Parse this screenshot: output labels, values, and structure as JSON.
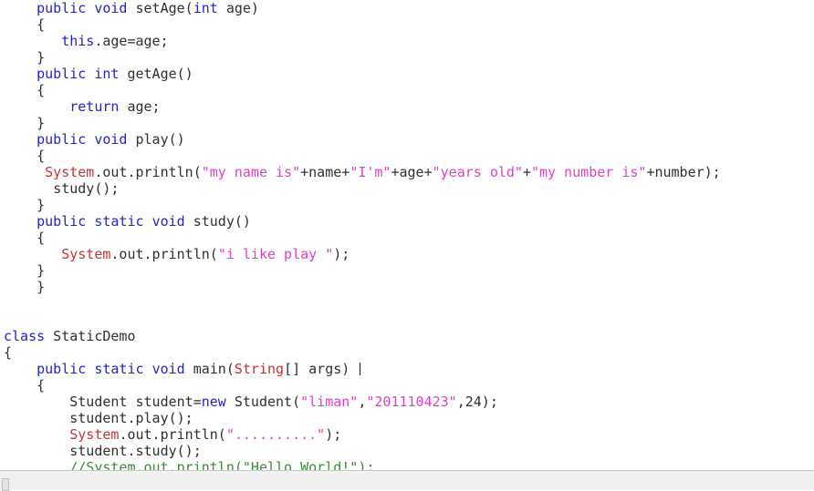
{
  "editor": {
    "language": "java",
    "background_color": "#ffffff",
    "font_size_px": 15,
    "line_height_px": 18,
    "colors": {
      "keyword": "#2424c8",
      "class_name": "#c83232",
      "string": "#e040c8",
      "comment": "#3c8c3c",
      "plain": "#303030"
    },
    "caret_after_line_index": 20,
    "lines": [
      {
        "indent": "    ",
        "tokens": [
          {
            "t": "public",
            "k": "kw"
          },
          {
            "t": " ",
            "k": "plain"
          },
          {
            "t": "void",
            "k": "kw"
          },
          {
            "t": " setAge(",
            "k": "plain"
          },
          {
            "t": "int",
            "k": "kw"
          },
          {
            "t": " age)",
            "k": "plain"
          }
        ]
      },
      {
        "indent": "    ",
        "tokens": [
          {
            "t": "{",
            "k": "plain"
          }
        ]
      },
      {
        "indent": "       ",
        "tokens": [
          {
            "t": "this",
            "k": "kw"
          },
          {
            "t": ".age=age;",
            "k": "plain"
          }
        ]
      },
      {
        "indent": "    ",
        "tokens": [
          {
            "t": "}",
            "k": "plain"
          }
        ]
      },
      {
        "indent": "    ",
        "tokens": [
          {
            "t": "public",
            "k": "kw"
          },
          {
            "t": " ",
            "k": "plain"
          },
          {
            "t": "int",
            "k": "kw"
          },
          {
            "t": " getAge()",
            "k": "plain"
          }
        ]
      },
      {
        "indent": "    ",
        "tokens": [
          {
            "t": "{",
            "k": "plain"
          }
        ]
      },
      {
        "indent": "        ",
        "tokens": [
          {
            "t": "return",
            "k": "kw"
          },
          {
            "t": " age;",
            "k": "plain"
          }
        ]
      },
      {
        "indent": "    ",
        "tokens": [
          {
            "t": "}",
            "k": "plain"
          }
        ]
      },
      {
        "indent": "    ",
        "tokens": [
          {
            "t": "public",
            "k": "kw"
          },
          {
            "t": " ",
            "k": "plain"
          },
          {
            "t": "void",
            "k": "kw"
          },
          {
            "t": " play()",
            "k": "plain"
          }
        ]
      },
      {
        "indent": "    ",
        "tokens": [
          {
            "t": "{",
            "k": "plain"
          }
        ]
      },
      {
        "indent": "     ",
        "tokens": [
          {
            "t": "System",
            "k": "cls"
          },
          {
            "t": ".out.println(",
            "k": "plain"
          },
          {
            "t": "\"my name is\"",
            "k": "str"
          },
          {
            "t": "+name+",
            "k": "plain"
          },
          {
            "t": "\"I'm\"",
            "k": "str"
          },
          {
            "t": "+age+",
            "k": "plain"
          },
          {
            "t": "\"years old\"",
            "k": "str"
          },
          {
            "t": "+",
            "k": "plain"
          },
          {
            "t": "\"my number is\"",
            "k": "str"
          },
          {
            "t": "+number);",
            "k": "plain"
          }
        ]
      },
      {
        "indent": "      ",
        "tokens": [
          {
            "t": "study();",
            "k": "plain"
          }
        ]
      },
      {
        "indent": "    ",
        "tokens": [
          {
            "t": "}",
            "k": "plain"
          }
        ]
      },
      {
        "indent": "    ",
        "tokens": [
          {
            "t": "public",
            "k": "kw"
          },
          {
            "t": " ",
            "k": "plain"
          },
          {
            "t": "static",
            "k": "kw"
          },
          {
            "t": " ",
            "k": "plain"
          },
          {
            "t": "void",
            "k": "kw"
          },
          {
            "t": " study()",
            "k": "plain"
          }
        ]
      },
      {
        "indent": "    ",
        "tokens": [
          {
            "t": "{",
            "k": "plain"
          }
        ]
      },
      {
        "indent": "       ",
        "tokens": [
          {
            "t": "System",
            "k": "cls"
          },
          {
            "t": ".out.println(",
            "k": "plain"
          },
          {
            "t": "\"i like play \"",
            "k": "str"
          },
          {
            "t": ");",
            "k": "plain"
          }
        ]
      },
      {
        "indent": "    ",
        "tokens": [
          {
            "t": "}",
            "k": "plain"
          }
        ]
      },
      {
        "indent": "    ",
        "tokens": [
          {
            "t": "}",
            "k": "plain"
          }
        ]
      },
      {
        "indent": "",
        "tokens": []
      },
      {
        "indent": "",
        "tokens": []
      },
      {
        "indent": "",
        "tokens": [
          {
            "t": "class",
            "k": "kw"
          },
          {
            "t": " StaticDemo",
            "k": "plain"
          }
        ]
      },
      {
        "indent": "",
        "tokens": [
          {
            "t": "{",
            "k": "plain"
          }
        ]
      },
      {
        "indent": "    ",
        "tokens": [
          {
            "t": "public",
            "k": "kw"
          },
          {
            "t": " ",
            "k": "plain"
          },
          {
            "t": "static",
            "k": "kw"
          },
          {
            "t": " ",
            "k": "plain"
          },
          {
            "t": "void",
            "k": "kw"
          },
          {
            "t": " main(",
            "k": "plain"
          },
          {
            "t": "String",
            "k": "cls"
          },
          {
            "t": "[] args) ",
            "k": "plain"
          }
        ],
        "caret": true
      },
      {
        "indent": "    ",
        "tokens": [
          {
            "t": "{",
            "k": "plain"
          }
        ]
      },
      {
        "indent": "        ",
        "tokens": [
          {
            "t": "Student student=",
            "k": "plain"
          },
          {
            "t": "new",
            "k": "kw"
          },
          {
            "t": " Student(",
            "k": "plain"
          },
          {
            "t": "\"liman\"",
            "k": "str"
          },
          {
            "t": ",",
            "k": "plain"
          },
          {
            "t": "\"201110423\"",
            "k": "str"
          },
          {
            "t": ",24);",
            "k": "plain"
          }
        ]
      },
      {
        "indent": "        ",
        "tokens": [
          {
            "t": "student.play();",
            "k": "plain"
          }
        ]
      },
      {
        "indent": "        ",
        "tokens": [
          {
            "t": "System",
            "k": "cls"
          },
          {
            "t": ".out.println(",
            "k": "plain"
          },
          {
            "t": "\"..........\"",
            "k": "str"
          },
          {
            "t": ");",
            "k": "plain"
          }
        ]
      },
      {
        "indent": "        ",
        "tokens": [
          {
            "t": "student.study();",
            "k": "plain"
          }
        ]
      },
      {
        "indent": "        ",
        "tokens": [
          {
            "t": "//System.out.println(\"Hello World!\");",
            "k": "cmt"
          }
        ]
      }
    ]
  },
  "scrollbar": {
    "orientation": "horizontal",
    "thumb_position": "left",
    "track_color": "#f0f0f0",
    "thumb_color": "#e4e4e4"
  }
}
